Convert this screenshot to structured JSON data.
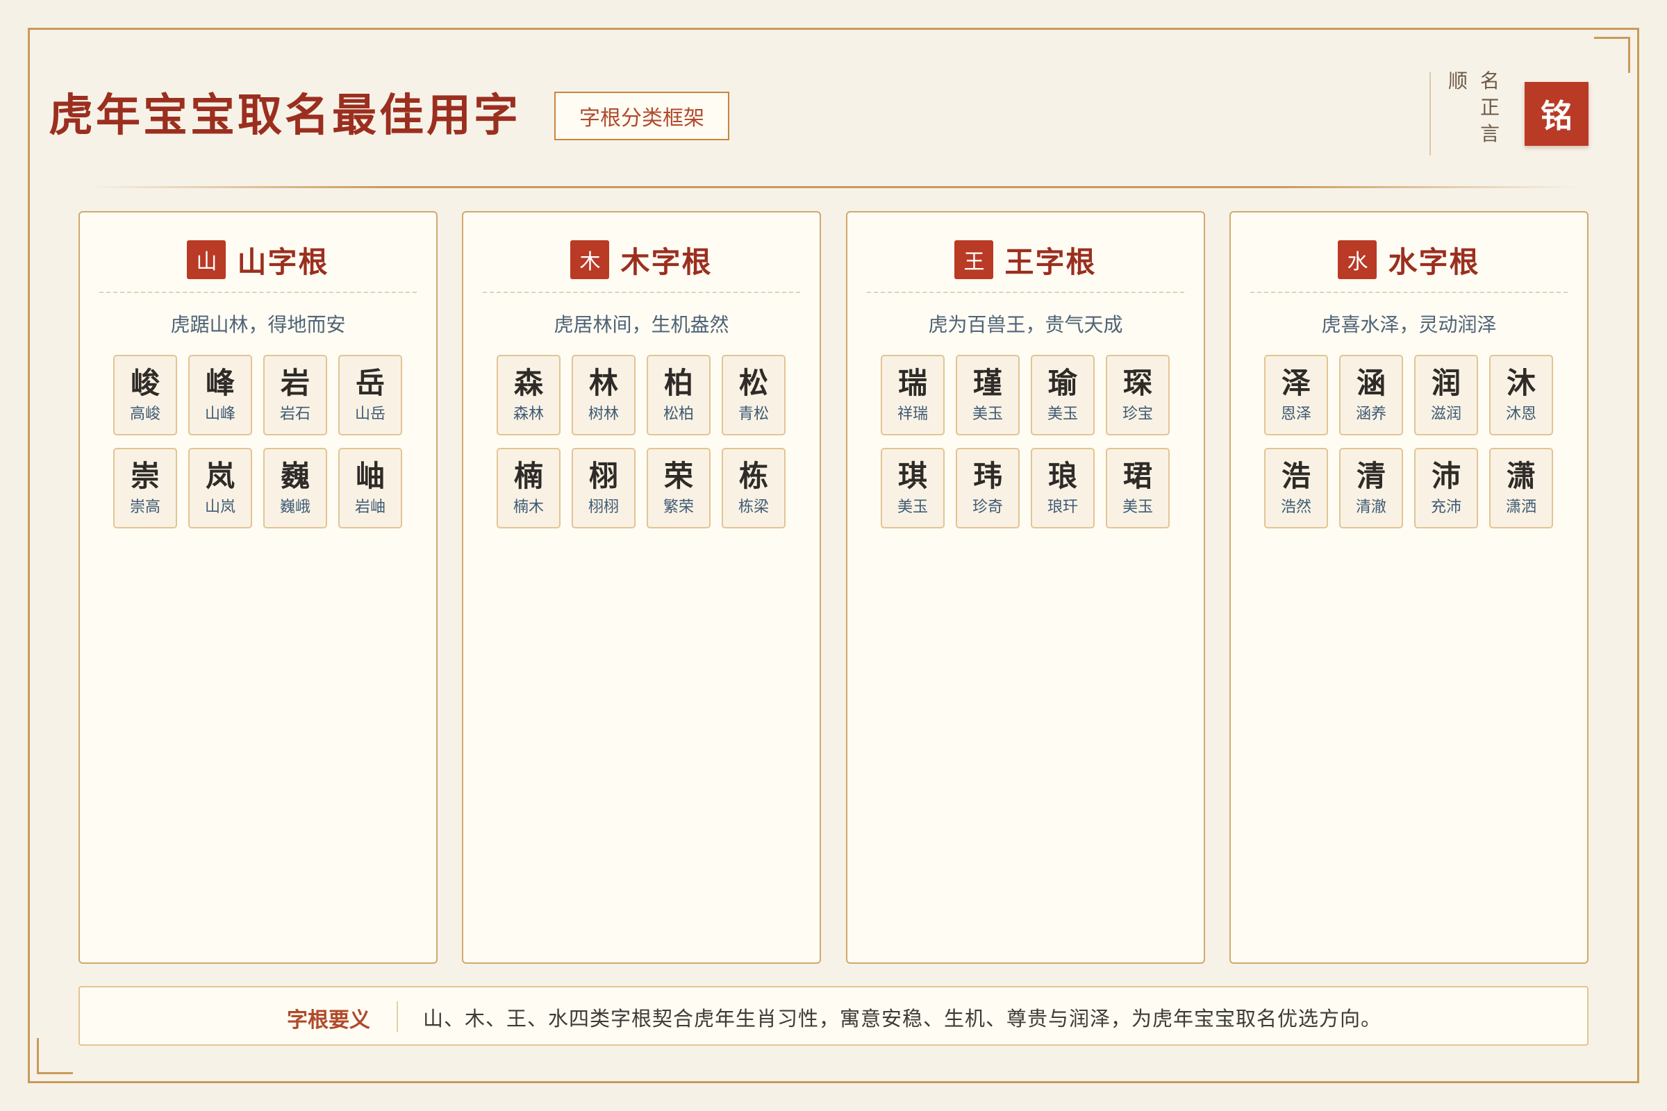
{
  "header": {
    "title": "虎年宝宝取名最佳用字",
    "subtitle": "字根分类框架",
    "brand_col1": [
      "顺"
    ],
    "brand_col2": [
      "名",
      "正",
      "言"
    ],
    "seal": "铭"
  },
  "colors": {
    "accent": "#b93a25",
    "title": "#9b2f1f",
    "border": "#c99a5b",
    "background": "#f6f1e7"
  },
  "cards": [
    {
      "badge": "山",
      "title": "山字根",
      "motto": "虎踞山林，得地而安",
      "chars": [
        {
          "ch": "峻",
          "word": "高峻"
        },
        {
          "ch": "峰",
          "word": "山峰"
        },
        {
          "ch": "岩",
          "word": "岩石"
        },
        {
          "ch": "岳",
          "word": "山岳"
        },
        {
          "ch": "崇",
          "word": "崇高"
        },
        {
          "ch": "岚",
          "word": "山岚"
        },
        {
          "ch": "巍",
          "word": "巍峨"
        },
        {
          "ch": "岫",
          "word": "岩岫"
        }
      ]
    },
    {
      "badge": "木",
      "title": "木字根",
      "motto": "虎居林间，生机盎然",
      "chars": [
        {
          "ch": "森",
          "word": "森林"
        },
        {
          "ch": "林",
          "word": "树林"
        },
        {
          "ch": "柏",
          "word": "松柏"
        },
        {
          "ch": "松",
          "word": "青松"
        },
        {
          "ch": "楠",
          "word": "楠木"
        },
        {
          "ch": "栩",
          "word": "栩栩"
        },
        {
          "ch": "荣",
          "word": "繁荣"
        },
        {
          "ch": "栋",
          "word": "栋梁"
        }
      ]
    },
    {
      "badge": "王",
      "title": "王字根",
      "motto": "虎为百兽王，贵气天成",
      "chars": [
        {
          "ch": "瑞",
          "word": "祥瑞"
        },
        {
          "ch": "瑾",
          "word": "美玉"
        },
        {
          "ch": "瑜",
          "word": "美玉"
        },
        {
          "ch": "琛",
          "word": "珍宝"
        },
        {
          "ch": "琪",
          "word": "美玉"
        },
        {
          "ch": "玮",
          "word": "珍奇"
        },
        {
          "ch": "琅",
          "word": "琅玕"
        },
        {
          "ch": "珺",
          "word": "美玉"
        }
      ]
    },
    {
      "badge": "水",
      "title": "水字根",
      "motto": "虎喜水泽，灵动润泽",
      "chars": [
        {
          "ch": "泽",
          "word": "恩泽"
        },
        {
          "ch": "涵",
          "word": "涵养"
        },
        {
          "ch": "润",
          "word": "滋润"
        },
        {
          "ch": "沐",
          "word": "沐恩"
        },
        {
          "ch": "浩",
          "word": "浩然"
        },
        {
          "ch": "清",
          "word": "清澈"
        },
        {
          "ch": "沛",
          "word": "充沛"
        },
        {
          "ch": "潇",
          "word": "潇洒"
        }
      ]
    }
  ],
  "footer": {
    "label": "字根要义",
    "text": "山、木、王、水四类字根契合虎年生肖习性，寓意安稳、生机、尊贵与润泽，为虎年宝宝取名优选方向。"
  }
}
